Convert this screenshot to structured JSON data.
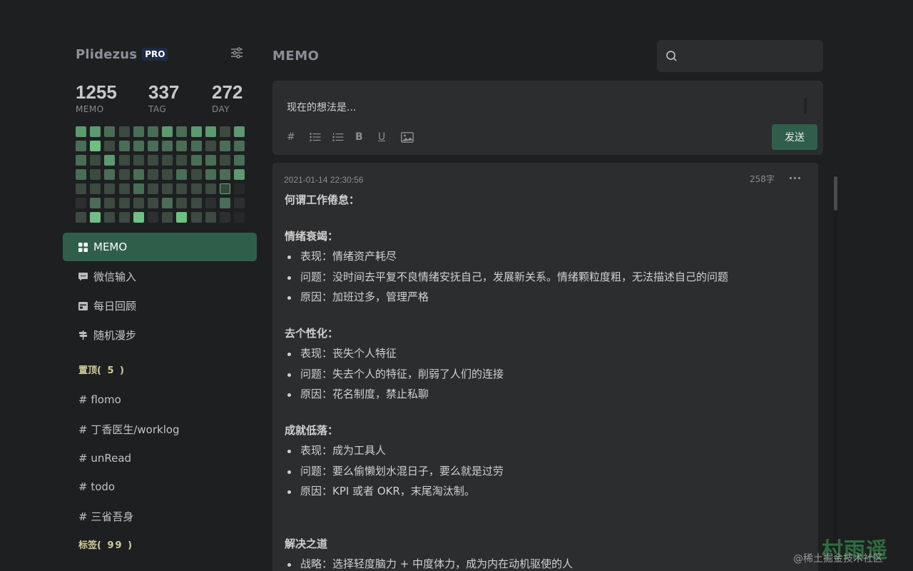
{
  "sidebar": {
    "brand": "Plidezus",
    "badge": "PRO",
    "stats": [
      {
        "value": "1255",
        "label": "MEMO"
      },
      {
        "value": "337",
        "label": "TAG"
      },
      {
        "value": "272",
        "label": "DAY"
      }
    ],
    "nav": [
      {
        "label": "MEMO",
        "icon": "grid-icon",
        "active": true
      },
      {
        "label": "微信输入",
        "icon": "chat-icon"
      },
      {
        "label": "每日回顾",
        "icon": "calendar-icon"
      },
      {
        "label": "随机漫步",
        "icon": "signpost-icon"
      }
    ],
    "pinned": {
      "title": "置顶",
      "count": "( 5 )"
    },
    "pinned_tags": [
      "# flomo",
      "# 丁香医生/worklog",
      "# unRead",
      "# todo",
      "# 三省吾身"
    ],
    "tags": {
      "title": "标签",
      "count": "( 99 )"
    }
  },
  "main": {
    "title": "MEMO",
    "search_placeholder": "",
    "editor_placeholder": "现在的想法是...",
    "send_label": "发送",
    "toolbar": {
      "hash": "#",
      "bold": "B",
      "underline": "U"
    }
  },
  "memo": {
    "time": "2021-01-14 22:30:56",
    "words": "258字",
    "title": "何谓工作倦怠：",
    "sections": [
      {
        "title": "情绪衰竭：",
        "items": [
          "表现：情绪资产耗尽",
          "问题：没时间去平复不良情绪安抚自己，发展新关系。情绪颗粒度粗，无法描述自己的问题",
          "原因：加班过多，管理严格"
        ]
      },
      {
        "title": "去个性化：",
        "items": [
          "表现：丧失个人特征",
          "问题：失去个人的特征，削弱了人们的连接",
          "原因：花名制度，禁止私聊"
        ]
      },
      {
        "title": "成就低落：",
        "items": [
          "表现：成为工具人",
          "问题：要么偷懒划水混日子，要么就是过劳",
          "原因：KPI 或者 OKR，末尾淘汰制。"
        ]
      }
    ],
    "solution": {
      "title": "解决之道",
      "items": [
        "战略：选择轻度脑力 + 中度体力，成为内在动机驱使的人"
      ]
    }
  },
  "watermark": {
    "big": "村雨遥",
    "small": "@稀土掘金技术社区"
  },
  "heatmap_levels": [
    [
      3,
      3,
      2,
      1,
      2,
      2,
      3,
      2,
      3,
      3,
      1,
      3
    ],
    [
      2,
      4,
      1,
      2,
      2,
      2,
      2,
      2,
      2,
      1,
      2,
      2
    ],
    [
      2,
      1,
      3,
      1,
      1,
      1,
      1,
      1,
      2,
      2,
      1,
      2
    ],
    [
      2,
      1,
      2,
      1,
      2,
      1,
      1,
      2,
      1,
      2,
      2,
      3
    ],
    [
      1,
      1,
      1,
      1,
      2,
      1,
      1,
      1,
      1,
      1,
      5,
      -1
    ],
    [
      0,
      2,
      1,
      1,
      1,
      1,
      2,
      1,
      1,
      0,
      2,
      0
    ],
    [
      1,
      4,
      1,
      1,
      4,
      0,
      1,
      4,
      1,
      1,
      0,
      -1
    ]
  ],
  "colors": {
    "accent": "#2f5f4b",
    "background": "#1e1f21",
    "card": "#2c2d2f",
    "pinned_title": "#d3ce9a"
  }
}
